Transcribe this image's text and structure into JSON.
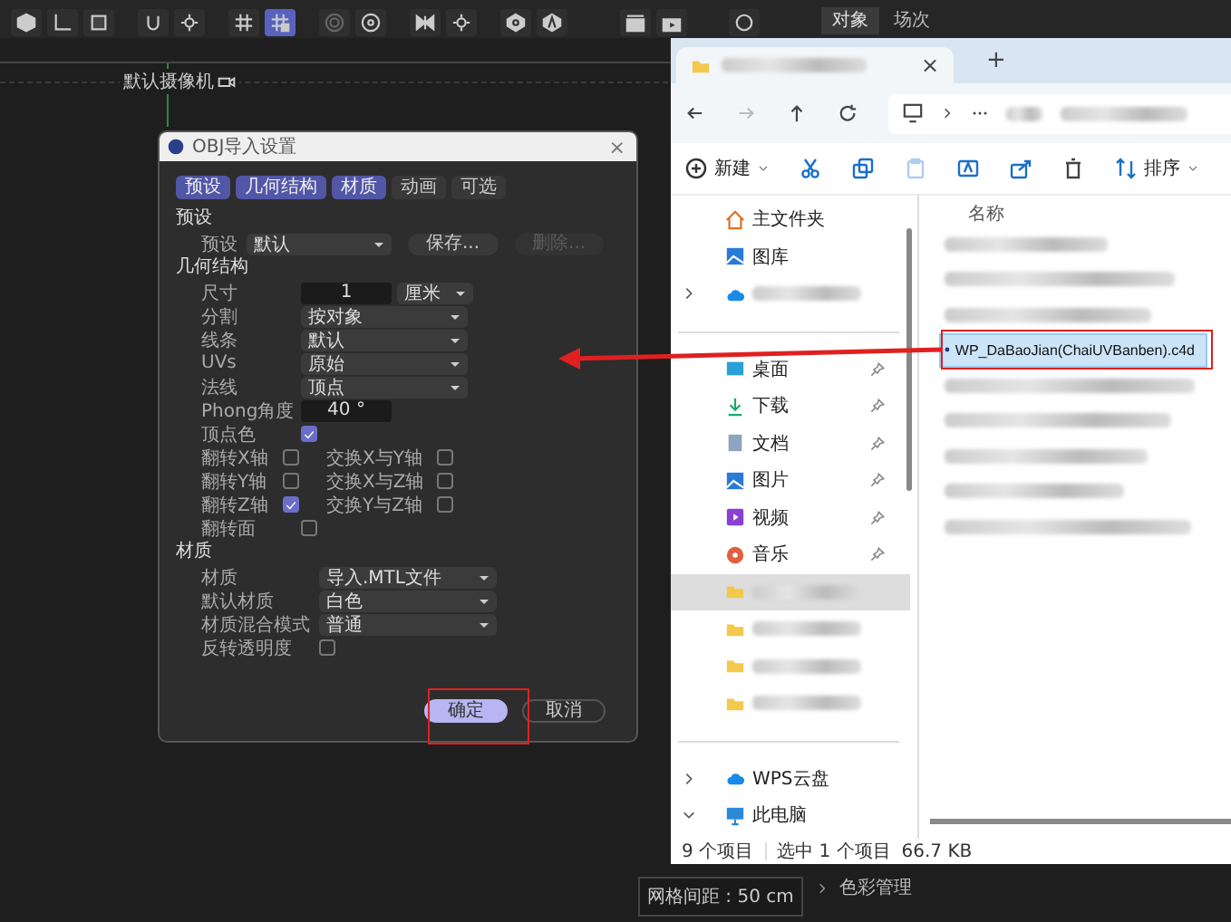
{
  "app": {
    "toolbar": [
      {
        "selected": false
      },
      {
        "selected": false
      },
      {
        "selected": false
      },
      {
        "selected": false
      },
      {
        "selected": false
      },
      {
        "selected": false
      },
      {
        "selected": true
      },
      {
        "selected": false
      },
      {
        "selected": false
      },
      {
        "selected": false
      },
      {
        "selected": false
      },
      {
        "selected": false
      },
      {
        "selected": false
      },
      {
        "selected": false
      },
      {
        "selected": false
      },
      {
        "selected": false
      }
    ],
    "panel_tabs": [
      {
        "label": "对象",
        "selected": true
      },
      {
        "label": "场次",
        "selected": false
      }
    ],
    "camera_label": "默认摄像机",
    "grid_status": "网格间距 : 50 cm",
    "color_management": "色彩管理"
  },
  "dialog": {
    "title": "OBJ导入设置",
    "close": "×",
    "tabs": [
      {
        "label": "预设",
        "selected": true
      },
      {
        "label": "几何结构",
        "selected": true
      },
      {
        "label": "材质",
        "selected": true
      },
      {
        "label": "动画",
        "selected": false
      },
      {
        "label": "可选",
        "selected": false
      }
    ],
    "sections": [
      {
        "kind": "preset",
        "title": "预设",
        "rows": [
          {
            "kind": "preset",
            "label": "预设",
            "value": "默认",
            "buttons": [
              {
                "label": "保存...",
                "disabled": false
              },
              {
                "label": "删除...",
                "disabled": true
              }
            ]
          }
        ]
      },
      {
        "kind": "geometry",
        "title": "几何结构",
        "rows": [
          {
            "kind": "number_unit",
            "label": "尺寸",
            "value": "1",
            "unit": "厘米"
          },
          {
            "kind": "dropdown",
            "label": "分割",
            "value": "按对象"
          },
          {
            "kind": "dropdown",
            "label": "线条",
            "value": "默认"
          },
          {
            "kind": "dropdown",
            "label": "UVs",
            "value": "原始"
          },
          {
            "kind": "dropdown",
            "label": "法线",
            "value": "顶点"
          },
          {
            "kind": "number",
            "label": "Phong角度",
            "value": "40 °"
          },
          {
            "kind": "checkbox",
            "label": "顶点色",
            "checked": true
          },
          {
            "kind": "checkbox_pair",
            "items": [
              {
                "label": "翻转X轴",
                "checked": false
              },
              {
                "label": "交换X与Y轴",
                "checked": false
              }
            ]
          },
          {
            "kind": "checkbox_pair",
            "items": [
              {
                "label": "翻转Y轴",
                "checked": false
              },
              {
                "label": "交换X与Z轴",
                "checked": false
              }
            ]
          },
          {
            "kind": "checkbox_pair",
            "items": [
              {
                "label": "翻转Z轴",
                "checked": true
              },
              {
                "label": "交换Y与Z轴",
                "checked": false
              }
            ]
          },
          {
            "kind": "checkbox",
            "label": "翻转面",
            "checked": false
          }
        ]
      },
      {
        "kind": "material",
        "title": "材质",
        "rows": [
          {
            "kind": "dropdown",
            "label": "材质",
            "value": "导入.MTL文件"
          },
          {
            "kind": "dropdown",
            "label": "默认材质",
            "value": "白色"
          },
          {
            "kind": "dropdown",
            "label": "材质混合模式",
            "value": "普通"
          },
          {
            "kind": "checkbox",
            "label": "反转透明度",
            "checked": false
          }
        ]
      }
    ],
    "buttons": [
      {
        "label": "确定",
        "kind": "primary"
      },
      {
        "label": "取消",
        "kind": "secondary"
      }
    ]
  },
  "explorer": {
    "tab_close": "×",
    "new_tab": "+",
    "commands": [
      {
        "kind": "new",
        "label": "新建",
        "disabled": false
      },
      {
        "kind": "cut",
        "disabled": false
      },
      {
        "kind": "copy",
        "disabled": false
      },
      {
        "kind": "paste",
        "disabled": true
      },
      {
        "kind": "rename",
        "disabled": false
      },
      {
        "kind": "share",
        "disabled": false
      },
      {
        "kind": "delete",
        "disabled": false
      },
      {
        "kind": "sort",
        "label": "排序",
        "disabled": false
      }
    ],
    "column_header": "名称",
    "nav": [
      {
        "kind": "home",
        "label": "主文件夹",
        "pinned": false,
        "selected": false
      },
      {
        "kind": "gallery",
        "label": "图库",
        "pinned": false,
        "selected": false
      },
      {
        "kind": "cloud",
        "pinned": false,
        "expanded": false,
        "selected": false
      },
      {
        "kind": "divider"
      },
      {
        "kind": "desktop",
        "label": "桌面",
        "pinned": true,
        "selected": false
      },
      {
        "kind": "download",
        "label": "下载",
        "pinned": true,
        "selected": false
      },
      {
        "kind": "document",
        "label": "文档",
        "pinned": true,
        "selected": false
      },
      {
        "kind": "picture",
        "label": "图片",
        "pinned": true,
        "selected": false
      },
      {
        "kind": "video",
        "label": "视频",
        "pinned": true,
        "selected": false
      },
      {
        "kind": "music",
        "label": "音乐",
        "pinned": true,
        "selected": false
      },
      {
        "kind": "folder",
        "pinned": false,
        "selected": true
      },
      {
        "kind": "folder",
        "pinned": false,
        "selected": false
      },
      {
        "kind": "folder",
        "pinned": false,
        "selected": false
      },
      {
        "kind": "folder",
        "pinned": false,
        "selected": false
      },
      {
        "kind": "divider"
      },
      {
        "kind": "cloud",
        "label": "WPS云盘",
        "pinned": false,
        "expanded": false,
        "selected": false
      },
      {
        "kind": "computer",
        "label": "此电脑",
        "pinned": false,
        "expanded": true,
        "selected": false
      }
    ],
    "files": [
      {
        "kind": "blurred",
        "selected": false
      },
      {
        "kind": "blurred",
        "selected": false
      },
      {
        "kind": "blurred",
        "selected": false
      },
      {
        "kind": "file",
        "name": "WP_DaBaoJian(ChaiUVBanben).c4d",
        "selected": true
      },
      {
        "kind": "blurred",
        "selected": false
      },
      {
        "kind": "blurred",
        "selected": false
      },
      {
        "kind": "blurred",
        "selected": false
      },
      {
        "kind": "blurred",
        "selected": false
      },
      {
        "kind": "blurred",
        "selected": false
      }
    ],
    "status": {
      "count": "9 个项目",
      "selection": "选中 1 个项目",
      "size": "66.7 KB"
    }
  }
}
